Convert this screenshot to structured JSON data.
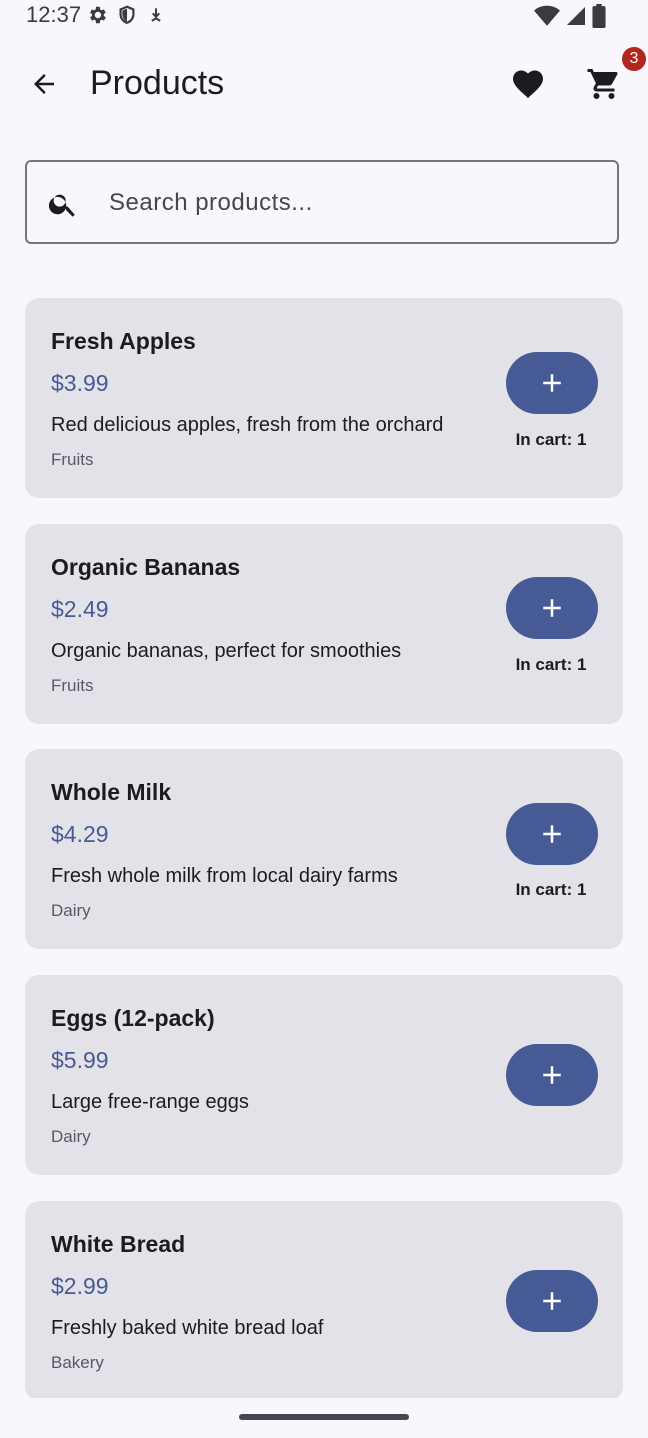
{
  "status_bar": {
    "time": "12:37",
    "left_icons": [
      "settings-gear-icon",
      "shield-icon",
      "download-icon"
    ],
    "right_icons": [
      "wifi-icon",
      "signal-icon",
      "battery-icon"
    ]
  },
  "header": {
    "title": "Products",
    "cart_badge_count": "3"
  },
  "search": {
    "placeholder": "Search products...",
    "value": ""
  },
  "products": [
    {
      "name": "Fresh Apples",
      "price": "$3.99",
      "description": "Red delicious apples, fresh from the orchard",
      "category": "Fruits",
      "in_cart": "In cart: 1"
    },
    {
      "name": "Organic Bananas",
      "price": "$2.49",
      "description": "Organic bananas, perfect for smoothies",
      "category": "Fruits",
      "in_cart": "In cart: 1"
    },
    {
      "name": "Whole Milk",
      "price": "$4.29",
      "description": "Fresh whole milk from local dairy farms",
      "category": "Dairy",
      "in_cart": "In cart: 1"
    },
    {
      "name": "Eggs (12-pack)",
      "price": "$5.99",
      "description": "Large free-range eggs",
      "category": "Dairy",
      "in_cart": ""
    },
    {
      "name": "White Bread",
      "price": "$2.99",
      "description": "Freshly baked white bread loaf",
      "category": "Bakery",
      "in_cart": ""
    }
  ],
  "colors": {
    "background": "#f8f7fd",
    "card": "#e4e2e9",
    "accent": "#465a95",
    "badge": "#b3261e"
  }
}
